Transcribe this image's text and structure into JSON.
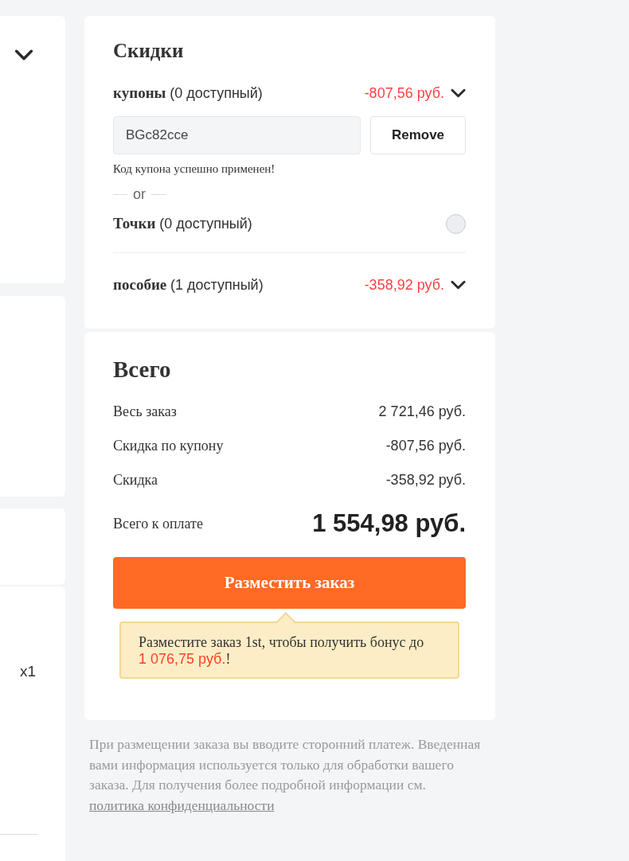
{
  "left_cards": [
    {
      "kind": "chevron"
    },
    {
      "kind": "blank"
    },
    {
      "kind": "blank"
    },
    {
      "kind": "quantity",
      "quantity": "x1"
    }
  ],
  "discounts": {
    "title": "Скидки",
    "coupons": {
      "label": "купоны",
      "available": "(0 доступный)",
      "amount": "-807,56 руб."
    },
    "coupon_field": {
      "value": "BGc82cce"
    },
    "remove_button": "Remove",
    "message": "Код купона успешно применен!",
    "separator": "or",
    "points": {
      "label": "Точки",
      "available": "(0 доступный)",
      "selected": false
    },
    "allowance": {
      "label": "пособие",
      "available": "(1 доступный)",
      "amount": "-358,92 руб."
    }
  },
  "total": {
    "title": "Всего",
    "lines": [
      {
        "label": "Весь заказ",
        "value": "2 721,46 руб."
      },
      {
        "label": "Скидка по купону",
        "value": "-807,56 руб."
      },
      {
        "label": "Скидка",
        "value": "-358,92 руб."
      }
    ],
    "grand_total": {
      "label": "Всего к оплате",
      "value": "1 554,98 руб."
    },
    "button": "Разместить заказ",
    "tooltip": {
      "text_before": "Разместите заказ 1st, чтобы получить бонус до ",
      "bonus": "1 076,75 руб.",
      "text_after": "!"
    }
  },
  "footer": {
    "text": "При размещении заказа вы вводите сторонний платеж. Введенная вами информация используется только для обработки вашего заказа. Для получения более подробной информации см.",
    "link": "политика конфиденциальности"
  }
}
